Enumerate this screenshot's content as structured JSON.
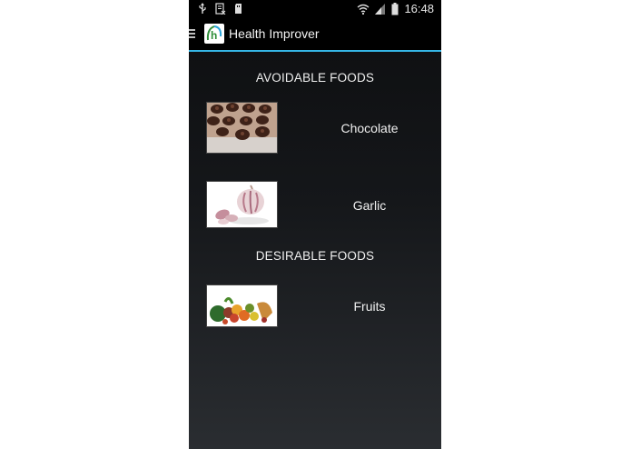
{
  "status_bar": {
    "time": "16:48",
    "icons": [
      "usb-icon",
      "download-icon",
      "sd-card-icon",
      "wifi-icon",
      "signal-icon",
      "battery-icon"
    ]
  },
  "action_bar": {
    "title": "Health Improver",
    "logo_letter": "h",
    "accent_color": "#35b6e6"
  },
  "sections": [
    {
      "title": "AVOIDABLE FOODS",
      "items": [
        {
          "label": "Chocolate",
          "image": "chocolate-image"
        },
        {
          "label": "Garlic",
          "image": "garlic-image"
        }
      ]
    },
    {
      "title": "DESIRABLE FOODS",
      "items": [
        {
          "label": "Fruits",
          "image": "fruits-image"
        }
      ]
    }
  ]
}
